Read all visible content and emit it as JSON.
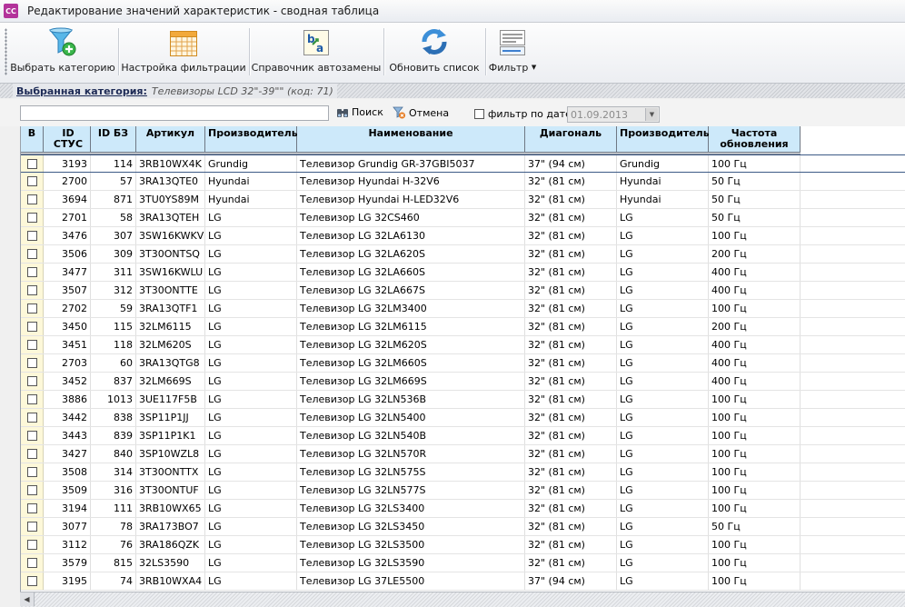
{
  "window": {
    "title": "Редактирование значений характеристик - сводная таблица",
    "icon_text": "CC"
  },
  "toolbar": {
    "buttons": [
      {
        "label": "Выбрать категорию"
      },
      {
        "label": "Настройка фильтрации"
      },
      {
        "label": "Справочник автозамены"
      },
      {
        "label": "Обновить список"
      },
      {
        "label": "Фильтр"
      }
    ]
  },
  "category": {
    "label": "Выбранная категория:",
    "value": "Телевизоры LCD 32\"-39\"\" (код: 71)"
  },
  "filter": {
    "search_value": "",
    "search_button": "Поиск",
    "cancel_button": "Отмена",
    "date_filter_label": "фильтр по дате",
    "date_value": "01.09.2013"
  },
  "grid": {
    "columns": [
      "B",
      "ID СТУС",
      "ID БЗ",
      "Артикул",
      "Производитель",
      "Наименование",
      "Диагональ",
      "Производитель",
      "Частота обновления"
    ],
    "rows": [
      [
        "3193",
        "114",
        "3RB10WX4K",
        "Grundig",
        "Телевизор Grundig GR-37GBI5037",
        "37\" (94 см)",
        "Grundig",
        "100 Гц"
      ],
      [
        "2700",
        "57",
        "3RA13QTE0",
        "Hyundai",
        "Телевизор Hyundai H-32V6",
        "32\" (81 см)",
        "Hyundai",
        "50 Гц"
      ],
      [
        "3694",
        "871",
        "3TU0YS89M",
        "Hyundai",
        "Телевизор Hyundai H-LED32V6",
        "32\" (81 см)",
        "Hyundai",
        "50 Гц"
      ],
      [
        "2701",
        "58",
        "3RA13QTEH",
        "LG",
        "Телевизор LG 32CS460",
        "32\" (81 см)",
        "LG",
        "50 Гц"
      ],
      [
        "3476",
        "307",
        "3SW16KWKV",
        "LG",
        "Телевизор LG 32LA6130",
        "32\" (81 см)",
        "LG",
        "100 Гц"
      ],
      [
        "3506",
        "309",
        "3T30ONTSQ",
        "LG",
        "Телевизор LG 32LA620S",
        "32\" (81 см)",
        "LG",
        "200 Гц"
      ],
      [
        "3477",
        "311",
        "3SW16KWLU",
        "LG",
        "Телевизор LG 32LA660S",
        "32\" (81 см)",
        "LG",
        "400 Гц"
      ],
      [
        "3507",
        "312",
        "3T30ONTTE",
        "LG",
        "Телевизор LG 32LA667S",
        "32\" (81 см)",
        "LG",
        "400 Гц"
      ],
      [
        "2702",
        "59",
        "3RA13QTF1",
        "LG",
        "Телевизор LG 32LM3400",
        "32\" (81 см)",
        "LG",
        "100 Гц"
      ],
      [
        "3450",
        "115",
        "32LM6115",
        "LG",
        "Телевизор LG 32LM6115",
        "32\" (81 см)",
        "LG",
        "200 Гц"
      ],
      [
        "3451",
        "118",
        "32LM620S",
        "LG",
        "Телевизор LG 32LM620S",
        "32\" (81 см)",
        "LG",
        "400 Гц"
      ],
      [
        "2703",
        "60",
        "3RA13QTG8",
        "LG",
        "Телевизор LG 32LM660S",
        "32\" (81 см)",
        "LG",
        "400 Гц"
      ],
      [
        "3452",
        "837",
        "32LM669S",
        "LG",
        "Телевизор LG 32LM669S",
        "32\" (81 см)",
        "LG",
        "400 Гц"
      ],
      [
        "3886",
        "1013",
        "3UE117F5B",
        "LG",
        "Телевизор LG 32LN536B",
        "32\" (81 см)",
        "LG",
        "100 Гц"
      ],
      [
        "3442",
        "838",
        "3SP11P1JJ",
        "LG",
        "Телевизор LG 32LN5400",
        "32\" (81 см)",
        "LG",
        "100 Гц"
      ],
      [
        "3443",
        "839",
        "3SP11P1K1",
        "LG",
        "Телевизор LG 32LN540B",
        "32\" (81 см)",
        "LG",
        "100 Гц"
      ],
      [
        "3427",
        "840",
        "3SP10WZL8",
        "LG",
        "Телевизор LG 32LN570R",
        "32\" (81 см)",
        "LG",
        "100 Гц"
      ],
      [
        "3508",
        "314",
        "3T30ONTTX",
        "LG",
        "Телевизор LG 32LN575S",
        "32\" (81 см)",
        "LG",
        "100 Гц"
      ],
      [
        "3509",
        "316",
        "3T30ONTUF",
        "LG",
        "Телевизор LG 32LN577S",
        "32\" (81 см)",
        "LG",
        "100 Гц"
      ],
      [
        "3194",
        "111",
        "3RB10WX65",
        "LG",
        "Телевизор LG 32LS3400",
        "32\" (81 см)",
        "LG",
        "100 Гц"
      ],
      [
        "3077",
        "78",
        "3RA173BO7",
        "LG",
        "Телевизор LG 32LS3450",
        "32\" (81 см)",
        "LG",
        "50 Гц"
      ],
      [
        "3112",
        "76",
        "3RA186QZK",
        "LG",
        "Телевизор LG 32LS3500",
        "32\" (81 см)",
        "LG",
        "100 Гц"
      ],
      [
        "3579",
        "815",
        "32LS3590",
        "LG",
        "Телевизор LG 32LS3590",
        "32\" (81 см)",
        "LG",
        "100 Гц"
      ],
      [
        "3195",
        "74",
        "3RB10WXA4",
        "LG",
        "Телевизор LG 37LE5500",
        "37\" (94 см)",
        "LG",
        "100 Гц"
      ]
    ]
  }
}
